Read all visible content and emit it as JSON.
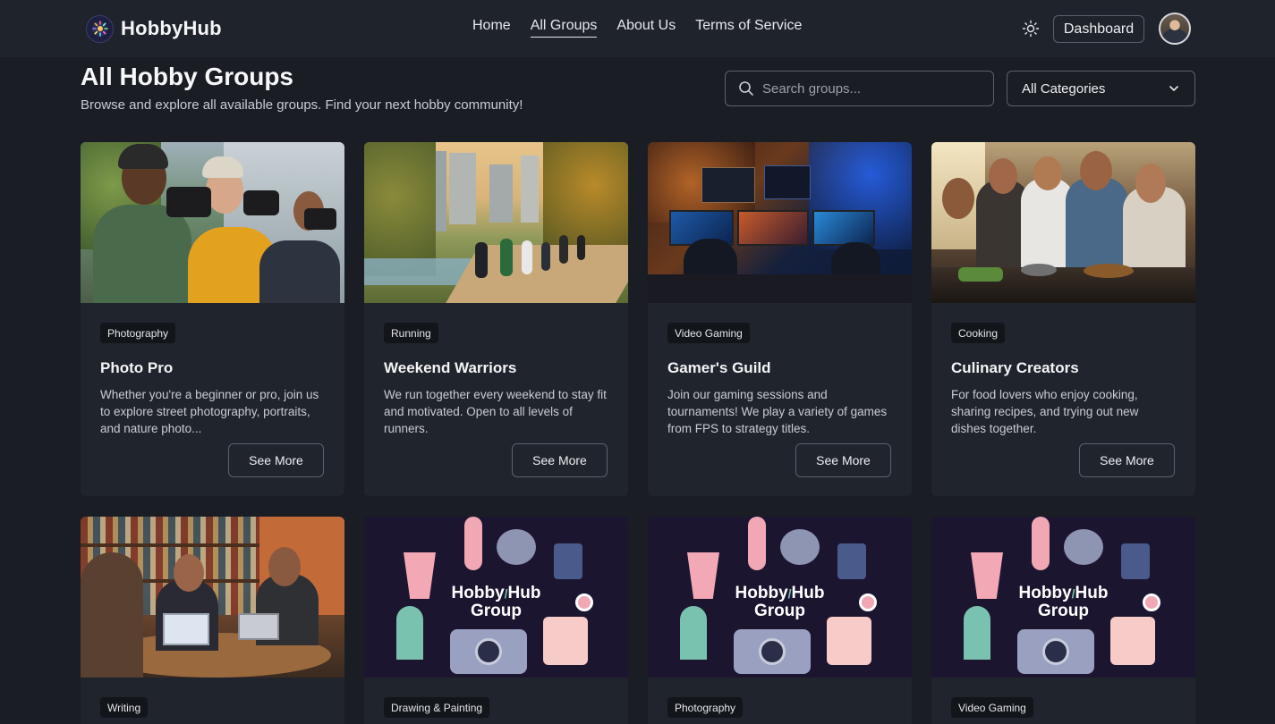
{
  "navbar": {
    "brand": "HobbyHub",
    "links": [
      {
        "label": "Home",
        "active": false
      },
      {
        "label": "All Groups",
        "active": true
      },
      {
        "label": "About Us",
        "active": false
      },
      {
        "label": "Terms of Service",
        "active": false
      }
    ],
    "theme_icon": "sun-icon",
    "dashboard_label": "Dashboard",
    "avatar": "user-avatar"
  },
  "header": {
    "title": "All Hobby Groups",
    "subtitle": "Browse and explore all available groups. Find your next hobby community!"
  },
  "search": {
    "placeholder": "Search groups...",
    "value": ""
  },
  "category_filter": {
    "selected": "All Categories"
  },
  "cards": [
    {
      "category": "Photography",
      "title": "Photo Pro",
      "description": "Whether you're a beginner or pro, join us to explore street photography, portraits, and nature photo...",
      "button": "See More"
    },
    {
      "category": "Running",
      "title": "Weekend Warriors",
      "description": "We run together every weekend to stay fit and motivated. Open to all levels of runners.",
      "button": "See More"
    },
    {
      "category": "Video Gaming",
      "title": "Gamer's Guild",
      "description": "Join our gaming sessions and tournaments! We play a variety of games from FPS to strategy titles.",
      "button": "See More"
    },
    {
      "category": "Cooking",
      "title": "Culinary Creators",
      "description": "For food lovers who enjoy cooking, sharing recipes, and trying out new dishes together.",
      "button": "See More"
    },
    {
      "category": "Writing",
      "title": "",
      "description": "",
      "button": ""
    },
    {
      "category": "Drawing & Painting",
      "title": "",
      "description": "",
      "button": "",
      "image_text": [
        "Hobby",
        "Hub",
        "Group"
      ]
    },
    {
      "category": "Photography",
      "title": "",
      "description": "",
      "button": "",
      "image_text": [
        "Hobby",
        "Hub",
        "Group"
      ]
    },
    {
      "category": "Video Gaming",
      "title": "",
      "description": "",
      "button": "",
      "image_text": [
        "Hobby",
        "Hub",
        "Group"
      ]
    }
  ],
  "colors": {
    "background": "#1a1d24",
    "navbar": "#1f232b",
    "card": "#20242c",
    "tag": "#12151a",
    "border": "#5c616c",
    "placeholder_bg": "#1b1530",
    "placeholder_accent": "#f2a7b4"
  }
}
